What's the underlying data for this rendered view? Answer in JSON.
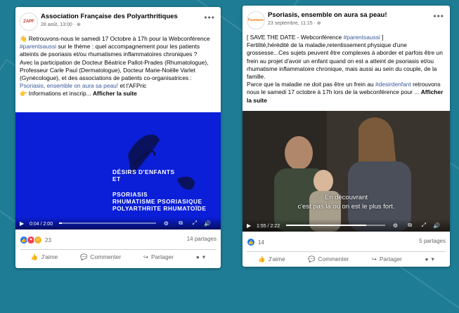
{
  "post1": {
    "avatar_text": "ZAPF",
    "page_name": "Association Française des Polyarthritiques",
    "meta": "28 août, 13:00 · ⊛",
    "text_a": "👋 Retrouvons-nous le samedi 17 Octobre à 17h pour la Webconférence ",
    "hashtag": "#parentsaussi",
    "text_b": " sur le thème : quel accompagnement pour les patients atteints de psoriasis et/ou rhumatismes inflammatoires chroniques ?",
    "text_c": "Avec la participation de Docteur Béatrice Pallot-Prades (Rhumatologue), Professeur Carle Paul (Dermatologue), Docteur Marie-Noëlle Varlet (Gynécologue), et des associations de patients co-organisatrices : ",
    "mention": "Psoriasis, ensemble on aura sa peau!",
    "text_d": " et l'AFPric",
    "text_e": "👉 Informations et inscrip...",
    "more": "Afficher la suite",
    "video_title_1": "DÉSIRS D'ENFANTS\nET",
    "video_title_2": "PSORIASIS\nRHUMATISME PSORIASIQUE\nPOLYARTHRITE RHUMATOÏDE",
    "time": "0:04 / 2:00",
    "progress": 0.03,
    "reactions_count": "23",
    "shares": "14 partages",
    "like": "J'aime",
    "comment": "Commenter",
    "share": "Partager"
  },
  "post2": {
    "avatar_text": "Psoriasis",
    "page_name": "Psoriasis, ensemble on aura sa peau!",
    "meta": "23 septembre, 11:15 · ⊛",
    "text_a": "[ SAVE THE DATE - Webconférence ",
    "hashtag": "#parentsaussi",
    "text_b": " ]",
    "text_c": "Fertilité,hérédité de la maladie,retentissement physique d'une grossesse...Ces sujets peuvent être complexes à aborder et parfois être un frein au projet d'avoir un enfant quand on est a atteint de psoriasis et/ou rhumatisme inflammatoire chronique, mais aussi au sein du couple, de la famille.",
    "text_d": "Parce que la maladie ne doit pas être un frein au ",
    "hashtag2": "#desirdenfant",
    "text_e": "retrouvons nous le samedi 17 octobre à 17h lors de la webconférence pour ... ",
    "more": "Afficher la suite",
    "subtitle_1": "En découvrant",
    "subtitle_2": "c'est pas là où on est le plus fort.",
    "time": "1:55 / 2:22",
    "progress": 0.81,
    "reactions_count": "14",
    "shares": "5 partages",
    "like": "J'aime",
    "comment": "Commenter",
    "share": "Partager"
  },
  "colors": {
    "background": "#1e7d95",
    "video1_bg": "#0b1fd8",
    "link": "#385898"
  }
}
